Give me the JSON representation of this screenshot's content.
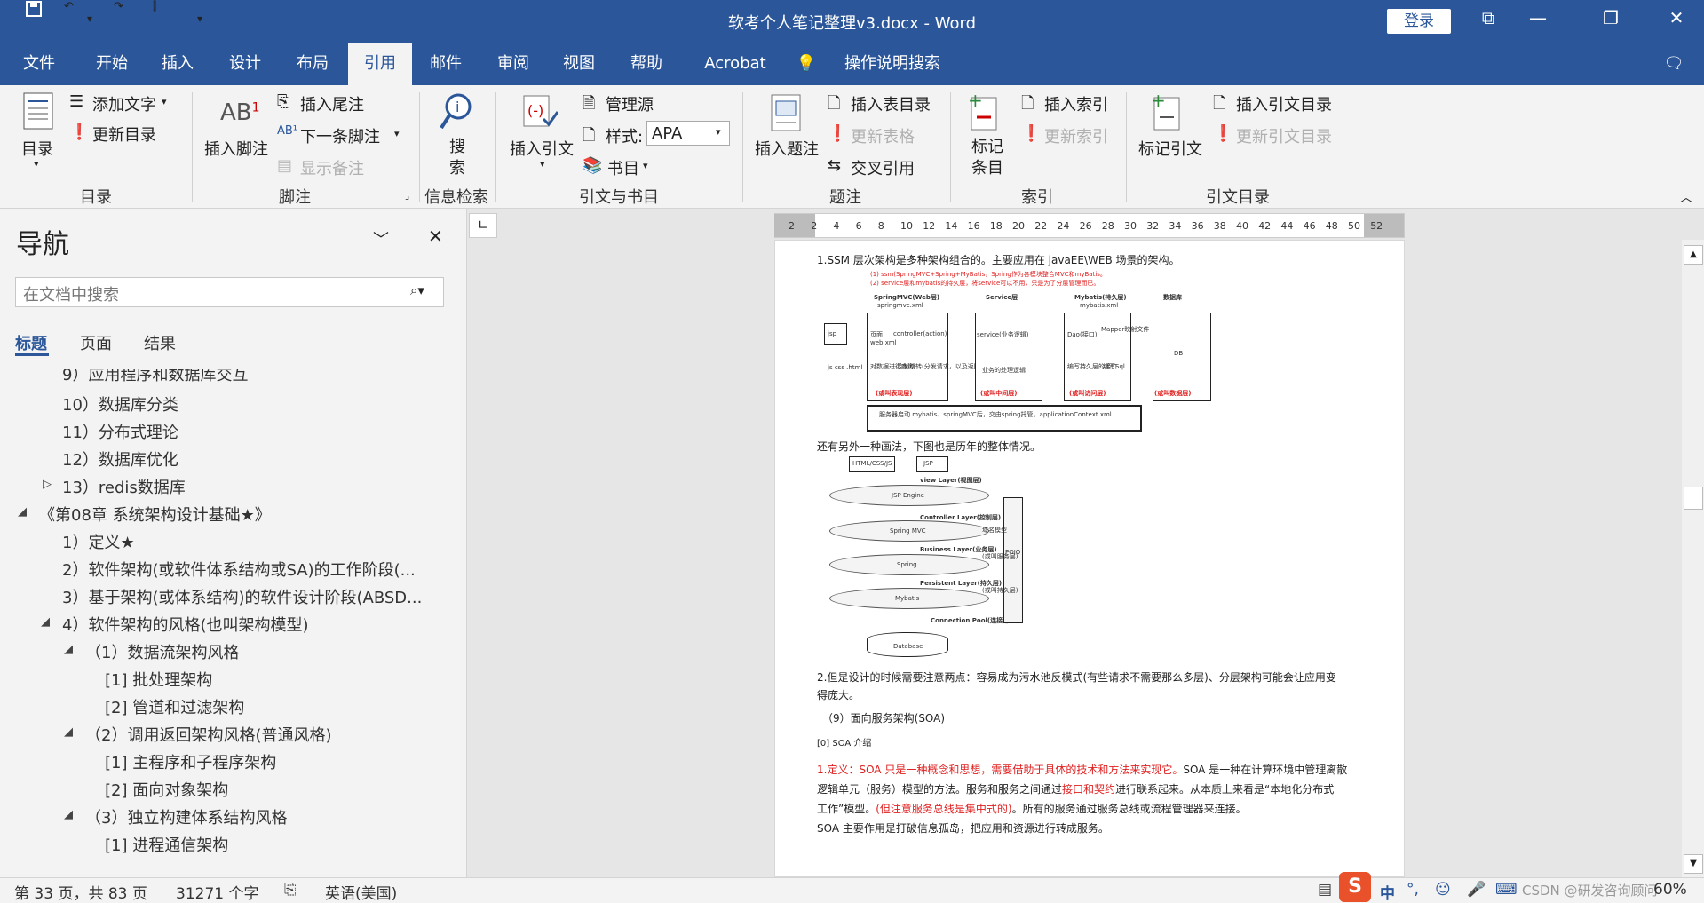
{
  "window": {
    "title": "软考个人笔记整理v3.docx  -  Word",
    "login": "登录"
  },
  "tabs": [
    "文件",
    "开始",
    "插入",
    "设计",
    "布局",
    "引用",
    "邮件",
    "审阅",
    "视图",
    "帮助",
    "Acrobat",
    "操作说明搜索"
  ],
  "active_tab": "引用",
  "ribbon": {
    "toc": {
      "toc_label": "目录",
      "add_text": "添加文字",
      "update_toc": "更新目录",
      "group": "目录"
    },
    "footnotes": {
      "insert_footnote": "插入脚注",
      "insert_endnote": "插入尾注",
      "next_footnote": "下一条脚注",
      "show_notes": "显示备注",
      "group": "脚注"
    },
    "research": {
      "search": "搜索",
      "group": "信息检索"
    },
    "citations": {
      "insert_citation": "插入引文",
      "manage_sources": "管理源",
      "style_label": "样式:",
      "style_value": "APA",
      "bibliography": "书目",
      "group": "引文与书目"
    },
    "captions": {
      "insert_caption": "插入题注",
      "insert_table_of_figures": "插入表目录",
      "update_table": "更新表格",
      "cross_reference": "交叉引用",
      "group": "题注"
    },
    "index": {
      "mark_entry": "标记条目",
      "insert_index": "插入索引",
      "update_index": "更新索引",
      "group": "索引"
    },
    "toa": {
      "mark_citation": "标记引文",
      "insert_toa": "插入引文目录",
      "update_toa": "更新引文目录",
      "group": "引文目录"
    }
  },
  "nav": {
    "title": "导航",
    "search_placeholder": "在文档中搜索",
    "tabs": [
      "标题",
      "页面",
      "结果"
    ],
    "items": [
      {
        "text": "9）应用程序和数据库交互",
        "level": 2
      },
      {
        "text": "10）数据库分类",
        "level": 2
      },
      {
        "text": "11）分布式理论",
        "level": 2
      },
      {
        "text": "12）数据库优化",
        "level": 2
      },
      {
        "text": "13）redis数据库",
        "level": 2
      },
      {
        "text": "《第08章 系统架构设计基础★》",
        "level": 1
      },
      {
        "text": "1）定义★",
        "level": 2
      },
      {
        "text": "2）软件架构(或软件体系结构或SA)的工作阶段(...",
        "level": 2
      },
      {
        "text": "3）基于架构(或体系结构)的软件设计阶段(ABSD...",
        "level": 2
      },
      {
        "text": "4）软件架构的风格(也叫架构模型)",
        "level": 2
      },
      {
        "text": "（1）数据流架构风格",
        "level": 3
      },
      {
        "text": "[1] 批处理架构",
        "level": 4
      },
      {
        "text": "[2] 管道和过滤架构",
        "level": 4
      },
      {
        "text": "（2）调用返回架构风格(普通风格)",
        "level": 3
      },
      {
        "text": "[1] 主程序和子程序架构",
        "level": 4
      },
      {
        "text": "[2] 面向对象架构",
        "level": 4
      },
      {
        "text": "（3）独立构建体系结构风格",
        "level": 3
      },
      {
        "text": "[1] 进程通信架构",
        "level": 4
      }
    ]
  },
  "ruler": [
    "2",
    "2",
    "4",
    "6",
    "8",
    "10",
    "12",
    "14",
    "16",
    "18",
    "20",
    "22",
    "24",
    "26",
    "28",
    "30",
    "32",
    "34",
    "36",
    "38",
    "40",
    "42",
    "44",
    "46",
    "48",
    "50",
    "52"
  ],
  "doc": {
    "p1": "1.SSM 层次架构是多种架构组合的。主要应用在 javaEE\\WEB 场景的架构。",
    "d1_note1": "(1) ssm(SpringMVC+Spring+MyBatis，Spring作为各模块整合MVC和myBatis。",
    "d1_note2": "(2) service层和mybatis的持久层，将service可以不用，只是为了分层管理而已。",
    "d1_cols": [
      "SpringMVC(Web层)",
      "Service层",
      "Mybatis(持久层)",
      "数据库"
    ],
    "d1_sub": [
      "springmvc.xml",
      "mybatis.xml"
    ],
    "d1_labels": [
      "(或叫表现层)",
      "(或叫中间层)",
      "(或叫访问层)",
      "(或叫数据层)"
    ],
    "d1_bottom": "服务器启动 mybatis、springMVC后，交由spring托管。applicationContext.xml",
    "d1_inner": [
      "jsp",
      "页面",
      "web.xml",
      "controller(action)",
      "service(业务逻辑)",
      "Dao(接口)",
      "Mapper映射文件",
      "DB",
      "对数据进行查询",
      "控制跳转(分发请求，以及返回model)",
      "业务的处理逻辑",
      "编写持久层的接口",
      "编写Sql",
      "js css .html"
    ],
    "p2": "还有另外一种画法，下图也是历年的整体情况。",
    "d2": [
      "HTML/CSS/JS",
      "JSP",
      "view Layer(视图层)",
      "JSP Engine",
      "Controller Layer(控制层)",
      "Spring MVC",
      "Business Layer(业务层)",
      "Spring",
      "Persistent Layer(持久层)",
      "Mybatis",
      "Connection Pool(连接池)",
      "Database",
      "POJO",
      "域名模型",
      "(或叫服务层)",
      "(或叫持久层)"
    ],
    "p3a": "2.但是设计的时候需要注意两点：容易成为污水池反模式(有些请求不需要那么多层)、分层架构可能会让应用变",
    "p3b": "得庞大。",
    "p4": "（9）面向服务架构(SOA)",
    "p5": "[0] SOA 介绍",
    "p6_red": "1.定义：SOA 只是一种概念和思想，需要借助于具体的技术和方法来实现它。",
    "p6_rest": "SOA 是一种在计算环境中管理离散",
    "p7a": "逻辑单元（服务）模型的方法。服务和服务之间通过",
    "p7_red": "接口和契约",
    "p7b": "进行联系起来。从本质上来看是“本地化分布式",
    "p8a": "工作”模型。",
    "p8_red": "(但注意服务总线是集中式的)",
    "p8b": "。所有的服务通过服务总线或流程管理器来连接。",
    "p9": "SOA 主要作用是打破信息孤岛，把应用和资源进行转成服务。"
  },
  "status": {
    "page": "第 33 页，共 83 页",
    "words": "31271 个字",
    "lang": "英语(美国)",
    "zoom": "60%",
    "watermark": "CSDN @研发咨询顾问"
  }
}
